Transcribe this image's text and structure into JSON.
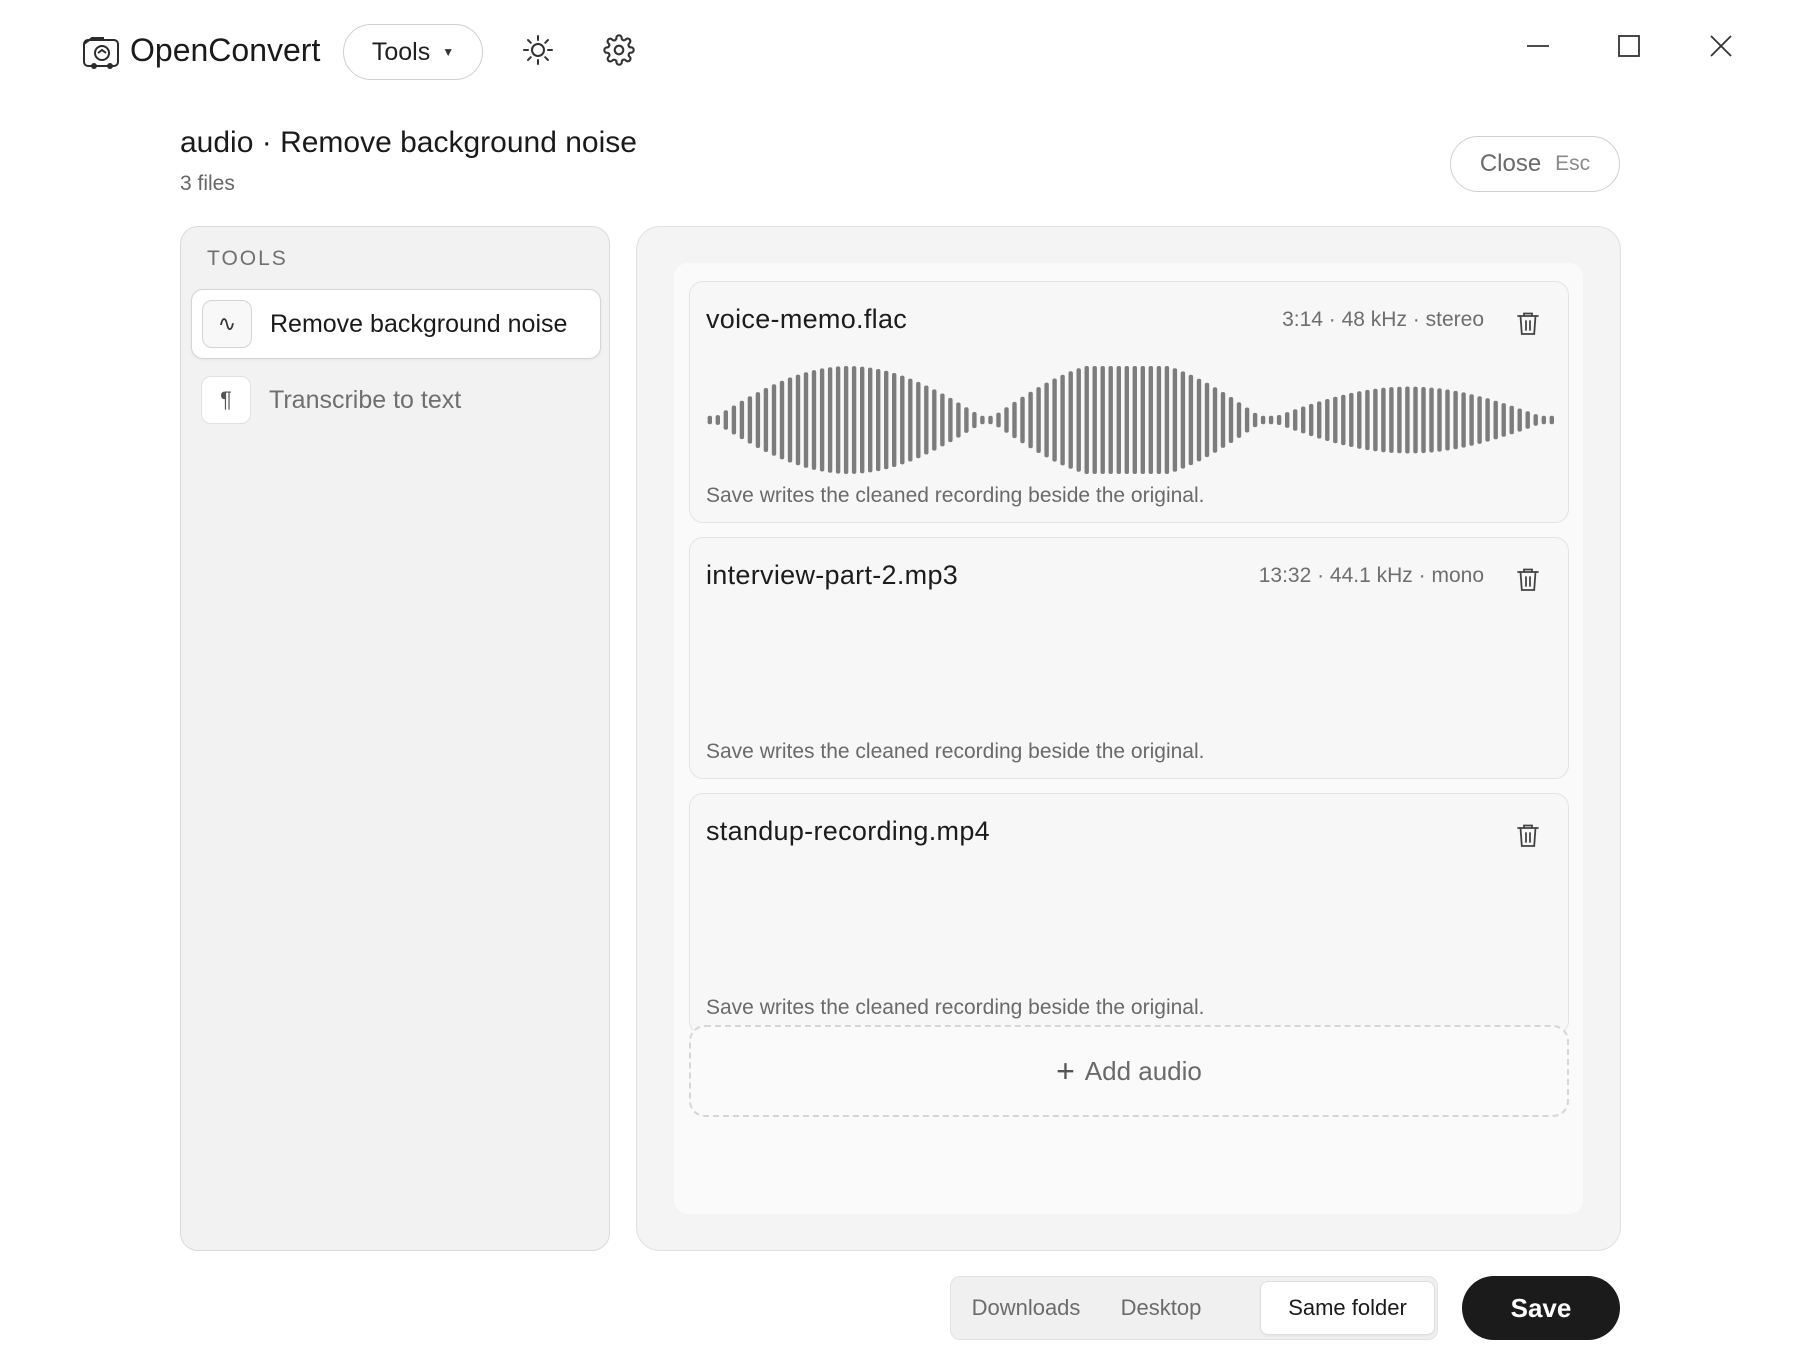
{
  "app": {
    "title": "OpenConvert",
    "tools_label": "Tools"
  },
  "header": {
    "title": "audio · Remove background noise",
    "file_count": "3 files",
    "close_label": "Close",
    "close_shortcut": "Esc"
  },
  "sidebar": {
    "heading": "TOOLS",
    "items": [
      {
        "label": "Remove background noise",
        "icon": "waveform-icon",
        "glyph": "∿",
        "active": true
      },
      {
        "label": "Transcribe to text",
        "icon": "pilcrow-icon",
        "glyph": "¶",
        "active": false
      }
    ]
  },
  "files": [
    {
      "name": "voice-memo.flac",
      "meta": "3:14 · 48 kHz · stereo",
      "note": "Save writes the cleaned recording beside the original.",
      "has_waveform": true
    },
    {
      "name": "interview-part-2.mp3",
      "meta": "13:32 · 44.1 kHz · mono",
      "note": "Save writes the cleaned recording beside the original.",
      "has_waveform": false
    },
    {
      "name": "standup-recording.mp4",
      "meta": "",
      "note": "Save writes the cleaned recording beside the original.",
      "has_waveform": false
    }
  ],
  "add_audio_label": "Add audio",
  "destinations": {
    "options": [
      "Downloads",
      "Desktop",
      "Same folder"
    ],
    "selected": "Same folder"
  },
  "save_label": "Save",
  "colors": {
    "save_bg": "#1b1b1b",
    "waveform_bar": "#7c7c7c"
  }
}
